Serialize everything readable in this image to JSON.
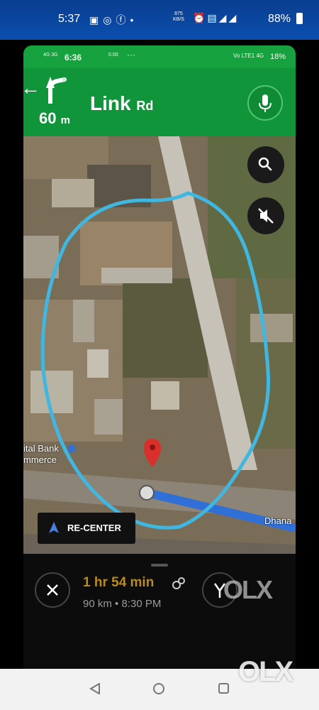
{
  "phone_status": {
    "time": "5:37",
    "net_speed": "875",
    "net_unit": "KB/S",
    "battery": "88%",
    "icons": [
      "image-icon",
      "instagram-icon",
      "facebook-icon",
      "dot-icon",
      "alarm-icon",
      "volte-icon",
      "signal-4g-icon",
      "signal-icon"
    ]
  },
  "inner_status": {
    "time": "6:36",
    "network_left": "4G 3G",
    "speed": "0.00",
    "dots": "···",
    "right": "Vo LTE1 4G",
    "battery": "18%"
  },
  "navigation": {
    "distance_value": "60",
    "distance_unit": "m",
    "street_name": "Link",
    "street_suffix": "Rd",
    "header_color": "#11953a"
  },
  "map": {
    "place_label_line1": "ital Bank",
    "place_label_line2": "mmerce",
    "road_label": "Dhana",
    "recenter_label": "RE-CENTER",
    "route_color": "#2f6fd6",
    "annotation_color": "#3fb7e0",
    "pin_color": "#d9302c"
  },
  "trip": {
    "eta_duration": "1 hr 54 min",
    "distance": "90 km",
    "separator": "•",
    "arrival": "8:30 PM",
    "eta_color": "#b88a1f"
  },
  "watermark": {
    "inline": "OLX",
    "corner": "OLX"
  }
}
